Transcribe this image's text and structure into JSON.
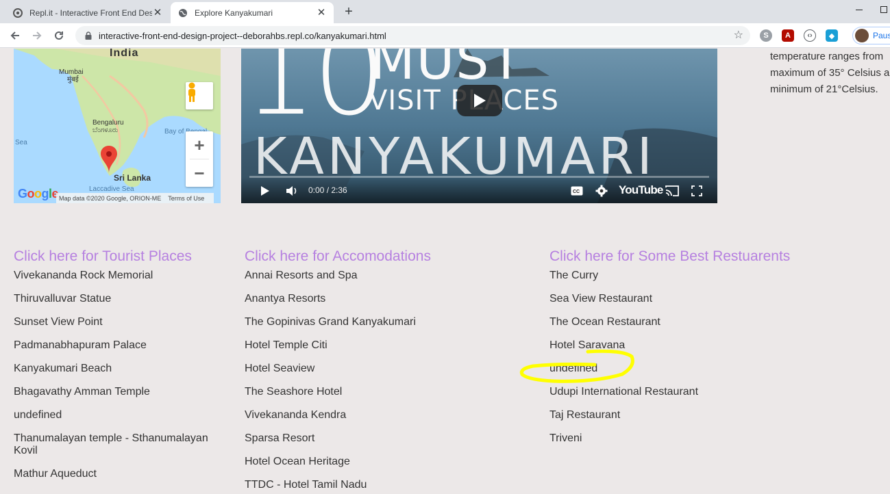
{
  "browser": {
    "tabs": [
      {
        "title": "Repl.it - Interactive Front End Des",
        "active": false,
        "icon": "replit-icon"
      },
      {
        "title": "Explore Kanyakumari",
        "active": true,
        "icon": "globe-icon"
      }
    ],
    "url": "interactive-front-end-design-project--deborahbs.repl.co/kanyakumari.html",
    "profile_label": "Paus"
  },
  "map": {
    "country": "India",
    "city_mumbai": "Mumbai",
    "city_mumbai_local": "मुंबई",
    "city_bengaluru": "Bengaluru",
    "city_bengaluru_local": "ಬೆಂಗಳೂರು",
    "srilanka": "Sri Lanka",
    "bay": "Bay of Bengal",
    "sea_left": "Sea",
    "laccadive": "Laccadive Sea",
    "google": "Google",
    "attribution": "Map data ©2020 Google, ORION-ME",
    "terms": "Terms of Use",
    "zoom_in": "+",
    "zoom_out": "−"
  },
  "video": {
    "num": "10",
    "must": "MUST",
    "visit": "VISIT PLACES",
    "place": "KANYAKUMARI",
    "time": "0:00 / 2:36",
    "brand": "YouTube"
  },
  "weather": {
    "lines": [
      "temperature ranges from",
      "maximum of 35° Celsius a",
      "minimum of 21°Celsius."
    ]
  },
  "tourist": {
    "heading": "Click here for Tourist Places",
    "items": [
      "Vivekananda Rock Memorial",
      "Thiruvalluvar Statue",
      "Sunset View Point",
      "Padmanabhapuram Palace",
      "Kanyakumari Beach",
      "Bhagavathy Amman Temple",
      "undefined",
      "Thanumalayan temple - Sthanumalayan Kovil",
      "Mathur Aqueduct"
    ]
  },
  "accommodations": {
    "heading": "Click here for Accomodations",
    "items": [
      "Annai Resorts and Spa",
      "Anantya Resorts",
      "The Gopinivas Grand Kanyakumari",
      "Hotel Temple Citi",
      "Hotel Seaview",
      "The Seashore Hotel",
      "Vivekananda Kendra",
      "Sparsa Resort",
      "Hotel Ocean Heritage",
      "TTDC - Hotel Tamil Nadu"
    ]
  },
  "restaurants": {
    "heading": "Click here for Some Best Restuarents",
    "items": [
      "The Curry",
      "Sea View Restaurant",
      "The Ocean Restaurant",
      "Hotel Saravana",
      "undefined",
      "Udupi International Restaurant",
      "Taj Restaurant",
      "Triveni"
    ]
  },
  "colors": {
    "heading": "#b680e0",
    "page_bg": "#ece8e8",
    "highlight": "#ffff00"
  }
}
